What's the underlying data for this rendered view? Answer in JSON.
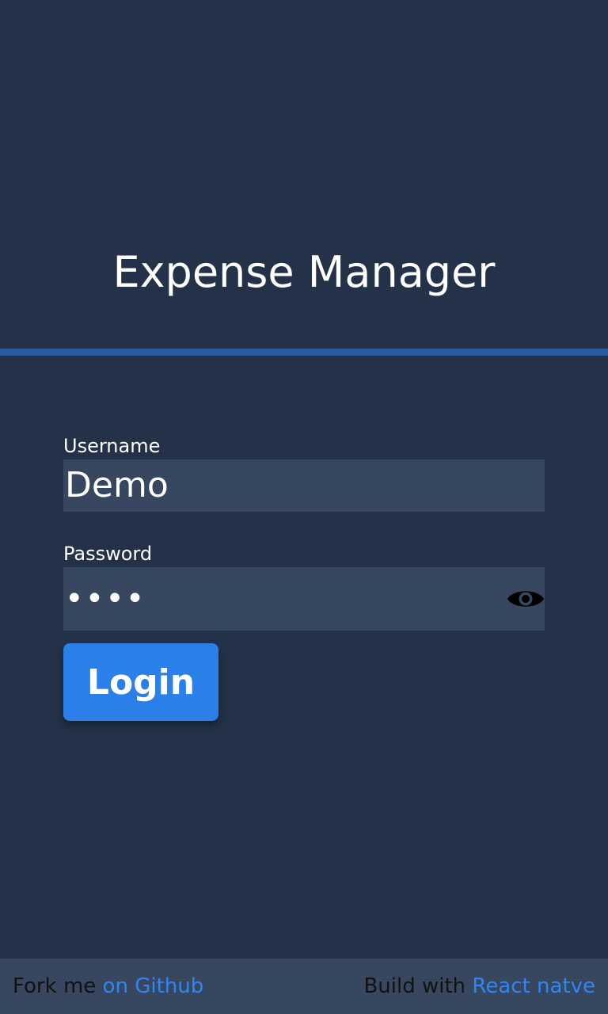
{
  "app": {
    "title": "Expense Manager"
  },
  "form": {
    "username_label": "Username",
    "username_value": "Demo",
    "password_label": "Password",
    "password_value": "demo",
    "login_label": "Login"
  },
  "footer": {
    "fork_text": "Fork me ",
    "fork_link": "on Github",
    "build_text": "Build with ",
    "build_link": "React natve"
  },
  "icons": {
    "password_toggle": "eye-icon"
  },
  "colors": {
    "background": "#233249",
    "divider": "#2c5aa0",
    "field_background": "#36475f",
    "button": "#2a7fe8",
    "link": "#2f86f5"
  }
}
